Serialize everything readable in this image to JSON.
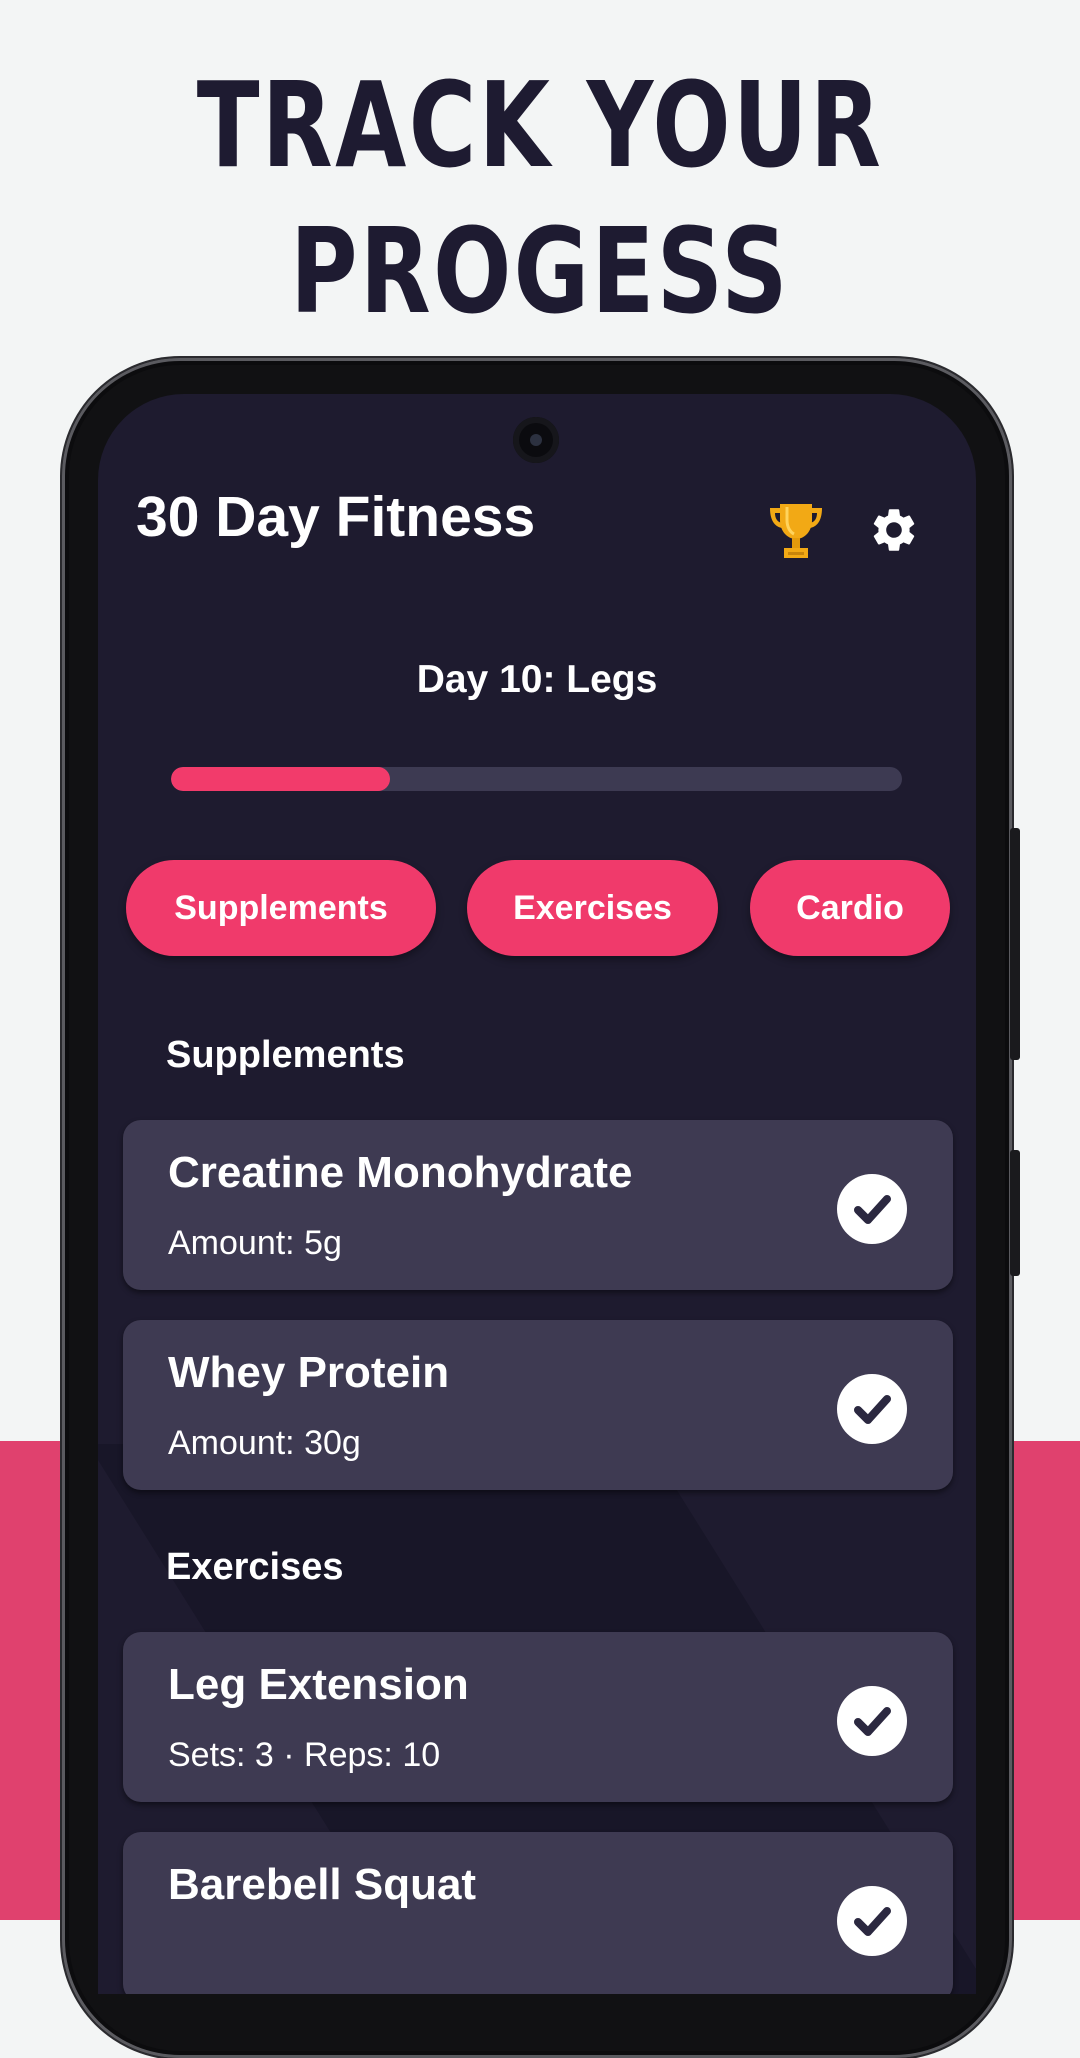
{
  "headline": {
    "line1": "TRACK YOUR",
    "line2": "PROGESS"
  },
  "colors": {
    "accent": "#f03a6b",
    "background": "#1e1b2f",
    "card": "#3e3a52",
    "band": "#e0416e"
  },
  "app": {
    "title": "30 Day Fitness",
    "icons": [
      "trophy-icon",
      "gear-icon"
    ]
  },
  "day": {
    "title": "Day 10: Legs",
    "progress_fraction": 0.3
  },
  "chips": [
    {
      "label": "Supplements"
    },
    {
      "label": "Exercises"
    },
    {
      "label": "Cardio"
    }
  ],
  "sections": {
    "supplements": {
      "label": "Supplements",
      "items": [
        {
          "title": "Creatine Monohydrate",
          "detail": "Amount: 5g",
          "checked": true
        },
        {
          "title": "Whey Protein",
          "detail": "Amount: 30g",
          "checked": true
        }
      ]
    },
    "exercises": {
      "label": "Exercises",
      "items": [
        {
          "title": "Leg Extension",
          "detail": "Sets: 3 · Reps: 10",
          "checked": true
        },
        {
          "title": "Barebell Squat",
          "detail": "",
          "checked": true
        }
      ]
    }
  }
}
